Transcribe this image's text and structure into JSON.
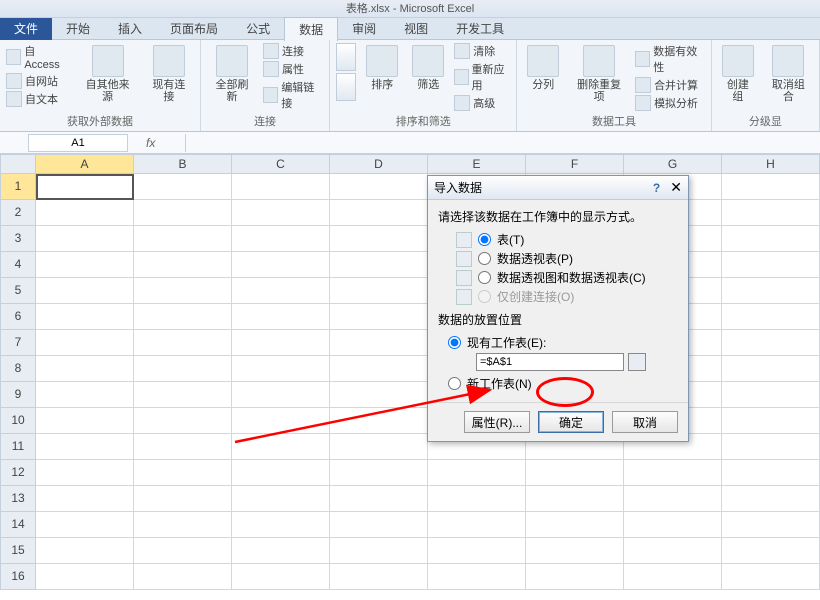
{
  "title": "表格.xlsx - Microsoft Excel",
  "tabs": {
    "file": "文件",
    "items": [
      "开始",
      "插入",
      "页面布局",
      "公式",
      "数据",
      "审阅",
      "视图",
      "开发工具"
    ],
    "active_index": 4
  },
  "ribbon": {
    "ext_data": {
      "access": "自 Access",
      "web": "自网站",
      "text": "自文本",
      "other": "自其他来源",
      "existing": "现有连接",
      "label": "获取外部数据"
    },
    "conn": {
      "refresh": "全部刷新",
      "connections": "连接",
      "properties": "属性",
      "edit_links": "编辑链接",
      "label": "连接"
    },
    "sort": {
      "sort": "排序",
      "filter": "筛选",
      "clear": "清除",
      "reapply": "重新应用",
      "advanced": "高级",
      "label": "排序和筛选"
    },
    "tools": {
      "ttc": "分列",
      "dup": "删除重复项",
      "valid": "数据有效性",
      "consol": "合并计算",
      "whatif": "模拟分析",
      "label": "数据工具"
    },
    "outline": {
      "group": "创建组",
      "ungroup": "取消组合",
      "label": "分级显"
    }
  },
  "namebox": "A1",
  "fx": "fx",
  "columns": [
    "A",
    "B",
    "C",
    "D",
    "E",
    "F",
    "G",
    "H"
  ],
  "rows": [
    "1",
    "2",
    "3",
    "4",
    "5",
    "6",
    "7",
    "8",
    "9",
    "10",
    "11",
    "12",
    "13",
    "14",
    "15",
    "16"
  ],
  "dialog": {
    "title": "导入数据",
    "prompt": "请选择该数据在工作簿中的显示方式。",
    "opts": {
      "table": "表(T)",
      "pivot": "数据透视表(P)",
      "pivotchart": "数据透视图和数据透视表(C)",
      "conn_only": "仅创建连接(O)"
    },
    "loc_label": "数据的放置位置",
    "loc_existing": "现有工作表(E):",
    "loc_ref": "=$A$1",
    "loc_new": "新工作表(N)",
    "btn_props": "属性(R)...",
    "btn_ok": "确定",
    "btn_cancel": "取消"
  }
}
